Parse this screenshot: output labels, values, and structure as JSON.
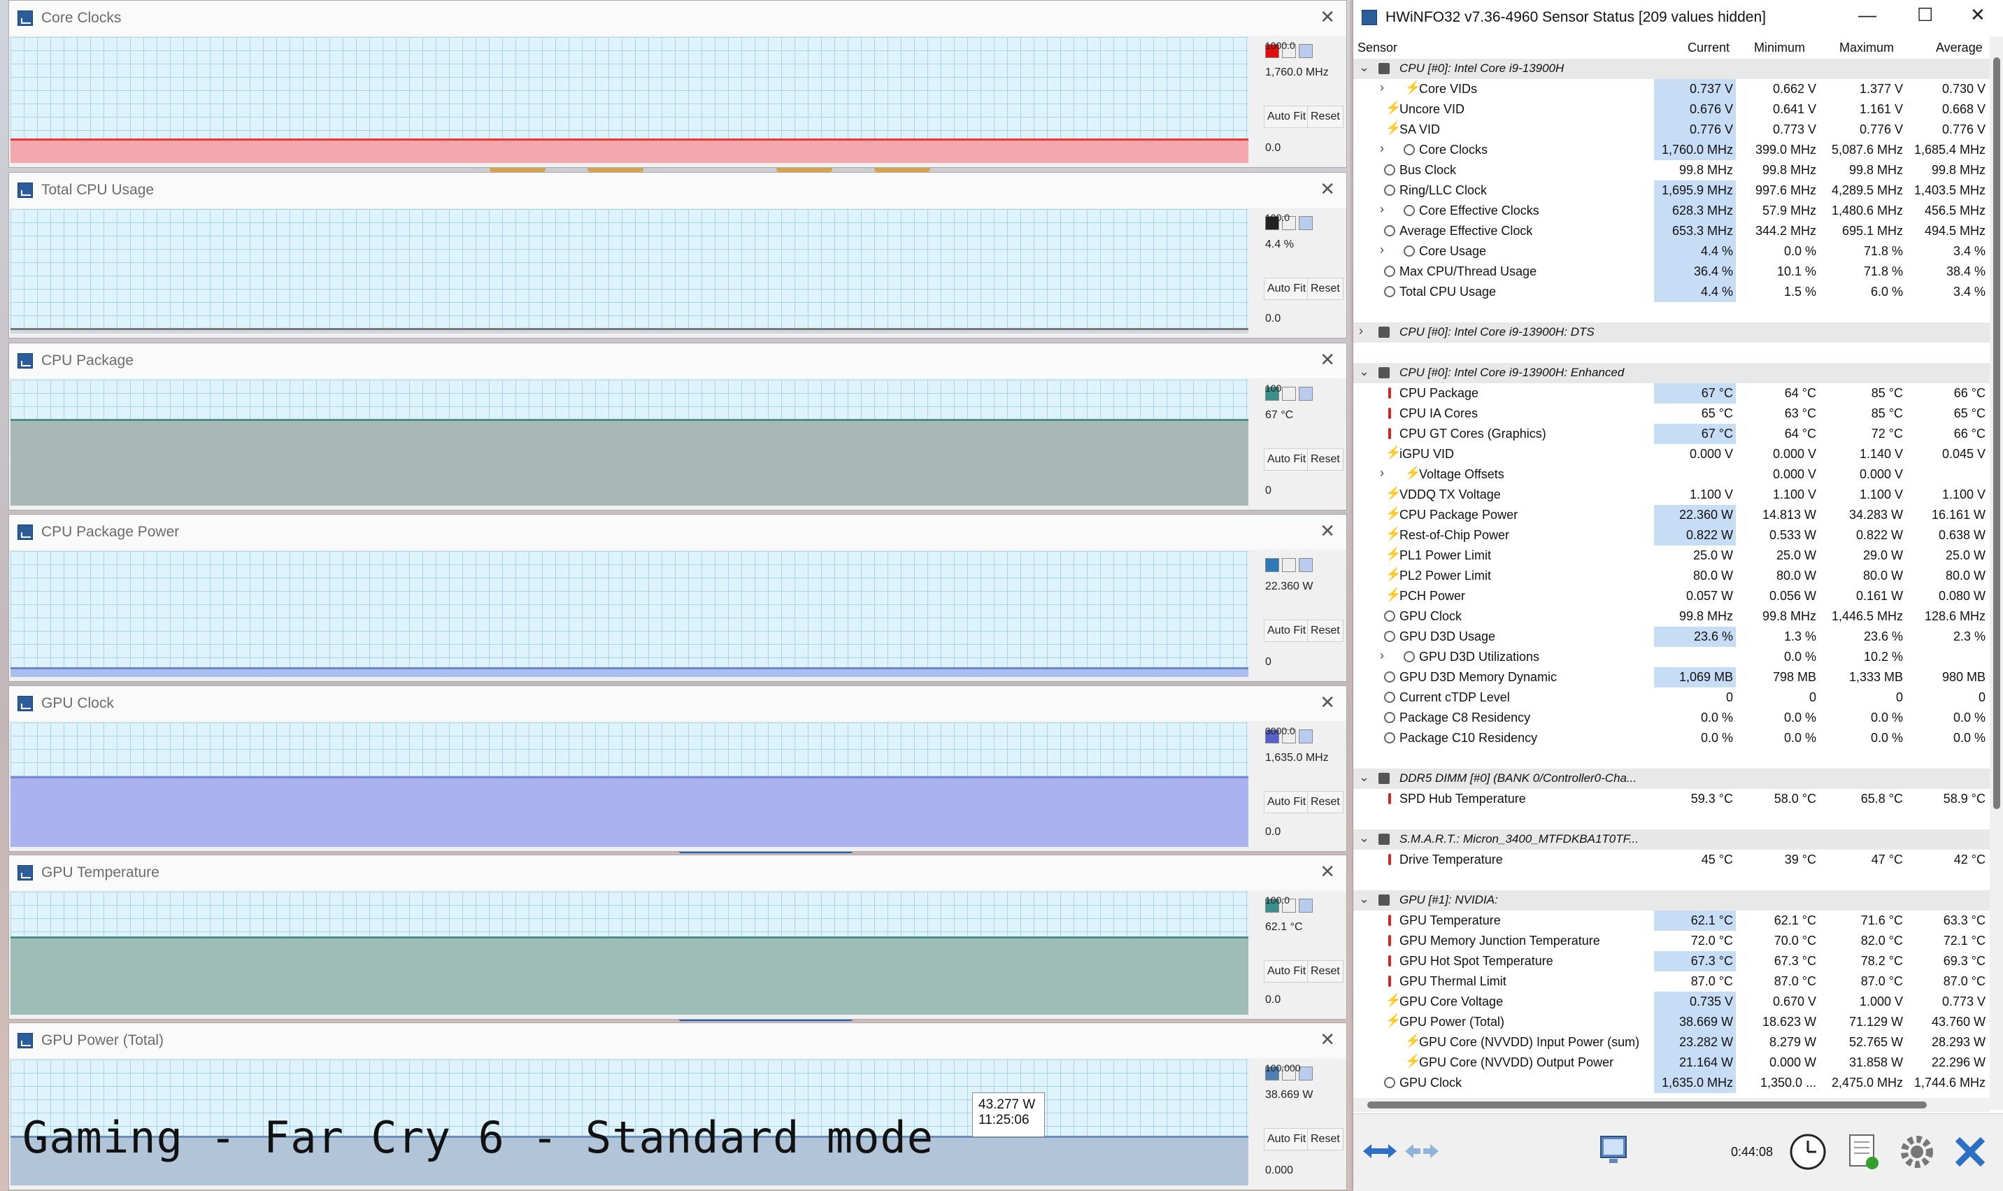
{
  "overlay_caption": "Gaming - Far Cry 6 - Standard mode",
  "graphs": [
    {
      "title": "Core Clocks",
      "top_value": "1000.0",
      "current": "1,760.0 MHz",
      "bottom": "0.0",
      "fill_color": "#f4a7ac",
      "line_color": "#e53935",
      "level": 0.18,
      "swatch": "#e01010"
    },
    {
      "title": "Total CPU Usage",
      "top_value": "100.0",
      "current": "4.4 %",
      "bottom": "0.0",
      "fill_color": "#cfd7df",
      "line_color": "#777",
      "level": 0.03,
      "swatch": "#222222"
    },
    {
      "title": "CPU Package",
      "top_value": "100",
      "current": "67 °C",
      "bottom": "0",
      "fill_color": "#a7b8b7",
      "line_color": "#4d8f86",
      "level": 0.67,
      "swatch": "#3a8f8a"
    },
    {
      "title": "CPU Package Power",
      "top_value": "",
      "current": "22.360 W",
      "bottom": "0",
      "fill_color": "#a9bff0",
      "line_color": "#6e86c8",
      "level": 0.06,
      "swatch": "#2f79b8"
    },
    {
      "title": "GPU Clock",
      "top_value": "3000.0",
      "current": "1,635.0 MHz",
      "bottom": "0.0",
      "fill_color": "#aab2f0",
      "line_color": "#7a86d6",
      "level": 0.55,
      "swatch": "#5560c8"
    },
    {
      "title": "GPU Temperature",
      "top_value": "100.0",
      "current": "62.1 °C",
      "bottom": "0.0",
      "fill_color": "#9fbdb7",
      "line_color": "#4d8f86",
      "level": 0.62,
      "swatch": "#3a8f8a"
    },
    {
      "title": "GPU Power (Total)",
      "top_value": "100.000",
      "current": "38.669 W",
      "bottom": "0.000",
      "fill_color": "#b1c4d8",
      "line_color": "#6a8fb6",
      "level": 0.38,
      "swatch": "#4d7fb2"
    }
  ],
  "graph_buttons": {
    "auto_fit": "Auto Fit",
    "reset": "Reset"
  },
  "tooltip": {
    "value": "43.277 W",
    "time": "11:25:06"
  },
  "hwinfo": {
    "title": "HWiNFO32 v7.36-4960 Sensor Status [209 values hidden]",
    "columns": [
      "Sensor",
      "Current",
      "Minimum",
      "Maximum",
      "Average"
    ],
    "rows": [
      {
        "type": "sec",
        "name": "CPU [#0]: Intel Core i9-13900H",
        "exp": "v"
      },
      {
        "type": "r",
        "icon": "volt",
        "exp": ">",
        "indent": 2,
        "name": "Core VIDs",
        "cur": "0.737 V",
        "min": "0.662 V",
        "max": "1.377 V",
        "avg": "0.730 V",
        "hl": true
      },
      {
        "type": "r",
        "icon": "volt",
        "name": "Uncore VID",
        "cur": "0.676 V",
        "min": "0.641 V",
        "max": "1.161 V",
        "avg": "0.668 V",
        "hl": true
      },
      {
        "type": "r",
        "icon": "volt",
        "name": "SA VID",
        "cur": "0.776 V",
        "min": "0.773 V",
        "max": "0.776 V",
        "avg": "0.776 V",
        "hl": true
      },
      {
        "type": "r",
        "icon": "clock",
        "exp": ">",
        "indent": 2,
        "name": "Core Clocks",
        "cur": "1,760.0 MHz",
        "min": "399.0 MHz",
        "max": "5,087.6 MHz",
        "avg": "1,685.4 MHz",
        "hl": true
      },
      {
        "type": "r",
        "icon": "clock",
        "name": "Bus Clock",
        "cur": "99.8 MHz",
        "min": "99.8 MHz",
        "max": "99.8 MHz",
        "avg": "99.8 MHz"
      },
      {
        "type": "r",
        "icon": "clock",
        "name": "Ring/LLC Clock",
        "cur": "1,695.9 MHz",
        "min": "997.6 MHz",
        "max": "4,289.5 MHz",
        "avg": "1,403.5 MHz",
        "hl": true
      },
      {
        "type": "r",
        "icon": "clock",
        "exp": ">",
        "indent": 2,
        "name": "Core Effective Clocks",
        "cur": "628.3 MHz",
        "min": "57.9 MHz",
        "max": "1,480.6 MHz",
        "avg": "456.5 MHz",
        "hl": true
      },
      {
        "type": "r",
        "icon": "clock",
        "name": "Average Effective Clock",
        "cur": "653.3 MHz",
        "min": "344.2 MHz",
        "max": "695.1 MHz",
        "avg": "494.5 MHz",
        "hl": true
      },
      {
        "type": "r",
        "icon": "clock",
        "exp": ">",
        "indent": 2,
        "name": "Core Usage",
        "cur": "4.4 %",
        "min": "0.0 %",
        "max": "71.8 %",
        "avg": "3.4 %",
        "hl": true
      },
      {
        "type": "r",
        "icon": "clock",
        "name": "Max CPU/Thread Usage",
        "cur": "36.4 %",
        "min": "10.1 %",
        "max": "71.8 %",
        "avg": "38.4 %",
        "hl": true
      },
      {
        "type": "r",
        "icon": "clock",
        "name": "Total CPU Usage",
        "cur": "4.4 %",
        "min": "1.5 %",
        "max": "6.0 %",
        "avg": "3.4 %",
        "hl": true
      },
      {
        "type": "blank"
      },
      {
        "type": "sec",
        "name": "CPU [#0]: Intel Core i9-13900H: DTS",
        "exp": ">"
      },
      {
        "type": "blank"
      },
      {
        "type": "sec",
        "name": "CPU [#0]: Intel Core i9-13900H: Enhanced",
        "exp": "v"
      },
      {
        "type": "r",
        "icon": "temp",
        "name": "CPU Package",
        "cur": "67 °C",
        "min": "64 °C",
        "max": "85 °C",
        "avg": "66 °C",
        "hl": true
      },
      {
        "type": "r",
        "icon": "temp",
        "name": "CPU IA Cores",
        "cur": "65 °C",
        "min": "63 °C",
        "max": "85 °C",
        "avg": "65 °C"
      },
      {
        "type": "r",
        "icon": "temp",
        "name": "CPU GT Cores (Graphics)",
        "cur": "67 °C",
        "min": "64 °C",
        "max": "72 °C",
        "avg": "66 °C",
        "hl": true
      },
      {
        "type": "r",
        "icon": "volt",
        "name": "iGPU VID",
        "cur": "0.000 V",
        "min": "0.000 V",
        "max": "1.140 V",
        "avg": "0.045 V"
      },
      {
        "type": "r",
        "icon": "volt",
        "exp": ">",
        "indent": 2,
        "name": "Voltage Offsets",
        "cur": "",
        "min": "0.000 V",
        "max": "0.000 V",
        "avg": ""
      },
      {
        "type": "r",
        "icon": "volt",
        "name": "VDDQ TX Voltage",
        "cur": "1.100 V",
        "min": "1.100 V",
        "max": "1.100 V",
        "avg": "1.100 V"
      },
      {
        "type": "r",
        "icon": "volt",
        "name": "CPU Package Power",
        "cur": "22.360 W",
        "min": "14.813 W",
        "max": "34.283 W",
        "avg": "16.161 W",
        "hl": true
      },
      {
        "type": "r",
        "icon": "volt",
        "name": "Rest-of-Chip Power",
        "cur": "0.822 W",
        "min": "0.533 W",
        "max": "0.822 W",
        "avg": "0.638 W",
        "hl": true
      },
      {
        "type": "r",
        "icon": "volt",
        "name": "PL1 Power Limit",
        "cur": "25.0 W",
        "min": "25.0 W",
        "max": "29.0 W",
        "avg": "25.0 W"
      },
      {
        "type": "r",
        "icon": "volt",
        "name": "PL2 Power Limit",
        "cur": "80.0 W",
        "min": "80.0 W",
        "max": "80.0 W",
        "avg": "80.0 W"
      },
      {
        "type": "r",
        "icon": "volt",
        "name": "PCH Power",
        "cur": "0.057 W",
        "min": "0.056 W",
        "max": "0.161 W",
        "avg": "0.080 W"
      },
      {
        "type": "r",
        "icon": "clock",
        "name": "GPU Clock",
        "cur": "99.8 MHz",
        "min": "99.8 MHz",
        "max": "1,446.5 MHz",
        "avg": "128.6 MHz"
      },
      {
        "type": "r",
        "icon": "clock",
        "name": "GPU D3D Usage",
        "cur": "23.6 %",
        "min": "1.3 %",
        "max": "23.6 %",
        "avg": "2.3 %",
        "hl": true
      },
      {
        "type": "r",
        "icon": "clock",
        "exp": ">",
        "indent": 2,
        "name": "GPU D3D Utilizations",
        "cur": "",
        "min": "0.0 %",
        "max": "10.2 %",
        "avg": ""
      },
      {
        "type": "r",
        "icon": "clock",
        "name": "GPU D3D Memory Dynamic",
        "cur": "1,069 MB",
        "min": "798 MB",
        "max": "1,333 MB",
        "avg": "980 MB",
        "hl": true
      },
      {
        "type": "r",
        "icon": "clock",
        "name": "Current cTDP Level",
        "cur": "0",
        "min": "0",
        "max": "0",
        "avg": "0"
      },
      {
        "type": "r",
        "icon": "clock",
        "name": "Package C8 Residency",
        "cur": "0.0 %",
        "min": "0.0 %",
        "max": "0.0 %",
        "avg": "0.0 %"
      },
      {
        "type": "r",
        "icon": "clock",
        "name": "Package C10 Residency",
        "cur": "0.0 %",
        "min": "0.0 %",
        "max": "0.0 %",
        "avg": "0.0 %"
      },
      {
        "type": "blank"
      },
      {
        "type": "sec",
        "name": "DDR5 DIMM [#0] (BANK 0/Controller0-Cha...",
        "exp": "v"
      },
      {
        "type": "r",
        "icon": "temp",
        "name": "SPD Hub Temperature",
        "cur": "59.3 °C",
        "min": "58.0 °C",
        "max": "65.8 °C",
        "avg": "58.9 °C"
      },
      {
        "type": "blank"
      },
      {
        "type": "sec",
        "name": "S.M.A.R.T.: Micron_3400_MTFDKBA1T0TF...",
        "exp": "v"
      },
      {
        "type": "r",
        "icon": "temp",
        "name": "Drive Temperature",
        "cur": "45 °C",
        "min": "39 °C",
        "max": "47 °C",
        "avg": "42 °C"
      },
      {
        "type": "blank"
      },
      {
        "type": "sec",
        "name": "GPU [#1]: NVIDIA:",
        "exp": "v"
      },
      {
        "type": "r",
        "icon": "temp",
        "name": "GPU Temperature",
        "cur": "62.1 °C",
        "min": "62.1 °C",
        "max": "71.6 °C",
        "avg": "63.3 °C",
        "hl": true
      },
      {
        "type": "r",
        "icon": "temp",
        "name": "GPU Memory Junction Temperature",
        "cur": "72.0 °C",
        "min": "70.0 °C",
        "max": "82.0 °C",
        "avg": "72.1 °C"
      },
      {
        "type": "r",
        "icon": "temp",
        "name": "GPU Hot Spot Temperature",
        "cur": "67.3 °C",
        "min": "67.3 °C",
        "max": "78.2 °C",
        "avg": "69.3 °C",
        "hl": true
      },
      {
        "type": "r",
        "icon": "temp",
        "name": "GPU Thermal Limit",
        "cur": "87.0 °C",
        "min": "87.0 °C",
        "max": "87.0 °C",
        "avg": "87.0 °C"
      },
      {
        "type": "r",
        "icon": "volt",
        "name": "GPU Core Voltage",
        "cur": "0.735 V",
        "min": "0.670 V",
        "max": "1.000 V",
        "avg": "0.773 V",
        "hl": true
      },
      {
        "type": "r",
        "icon": "volt",
        "name": "GPU Power (Total)",
        "cur": "38.669 W",
        "min": "18.623 W",
        "max": "71.129 W",
        "avg": "43.760 W",
        "hl": true
      },
      {
        "type": "r",
        "icon": "volt",
        "indent": 2,
        "name": "GPU Core (NVVDD) Input Power (sum)",
        "cur": "23.282 W",
        "min": "8.279 W",
        "max": "52.765 W",
        "avg": "28.293 W",
        "hl": true
      },
      {
        "type": "r",
        "icon": "volt",
        "indent": 2,
        "name": "GPU Core (NVVDD) Output Power",
        "cur": "21.164 W",
        "min": "0.000 W",
        "max": "31.858 W",
        "avg": "22.296 W",
        "hl": true
      },
      {
        "type": "r",
        "icon": "clock",
        "name": "GPU Clock",
        "cur": "1,635.0 MHz",
        "min": "1,350.0 ...",
        "max": "2,475.0 MHz",
        "avg": "1,744.6 MHz",
        "hl": true
      }
    ],
    "elapsed": "0:44:08"
  }
}
